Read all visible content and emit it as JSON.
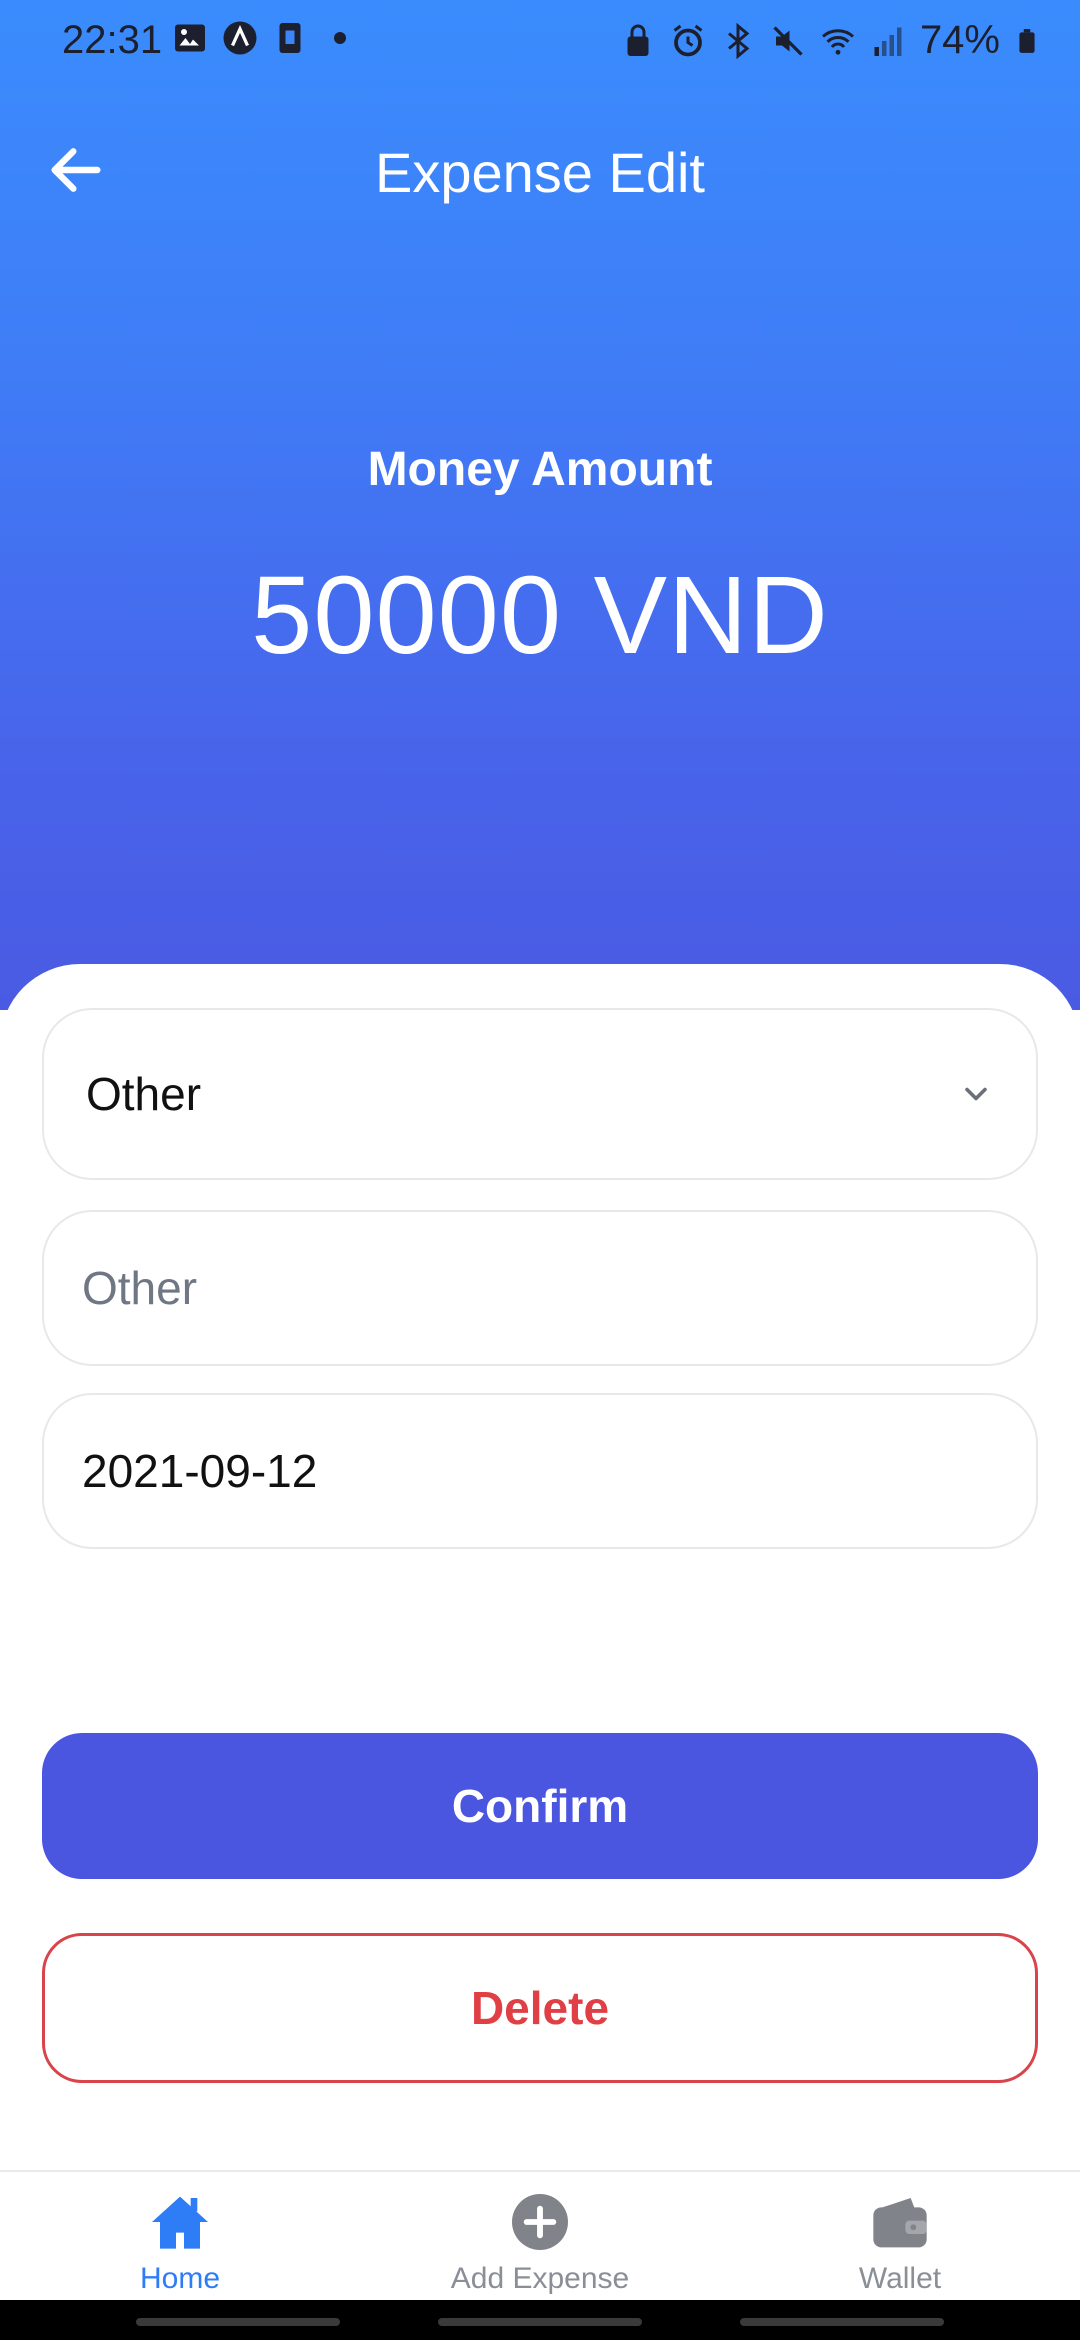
{
  "status_bar": {
    "time": "22:31",
    "battery": "74%",
    "left_icons": [
      "image-icon",
      "app-icon",
      "sim-icon",
      "dot-icon"
    ],
    "right_icons": [
      "lock-icon",
      "alarm-icon",
      "bluetooth-icon",
      "mute-icon",
      "wifi-icon",
      "signal-icon",
      "battery-icon"
    ]
  },
  "app_bar": {
    "title": "Expense Edit",
    "back_icon": "arrow-left-icon"
  },
  "amount": {
    "label": "Money Amount",
    "value": "50000 VND"
  },
  "form": {
    "category_value": "Other",
    "note_placeholder": "Other",
    "note_value": "",
    "date_value": "2021-09-12"
  },
  "actions": {
    "confirm_label": "Confirm",
    "delete_label": "Delete"
  },
  "bottom_nav": {
    "items": [
      {
        "label": "Home",
        "icon": "home-icon",
        "active": true
      },
      {
        "label": "Add Expense",
        "icon": "add-circle-icon",
        "active": false
      },
      {
        "label": "Wallet",
        "icon": "wallet-icon",
        "active": false
      }
    ]
  },
  "colors": {
    "gradient_top": "#3a8cfd",
    "gradient_bottom": "#4a5ae3",
    "confirm": "#4a55e0",
    "delete": "#e03f45",
    "active_nav": "#2e7cf6",
    "inactive_nav": "#8a8e96"
  }
}
